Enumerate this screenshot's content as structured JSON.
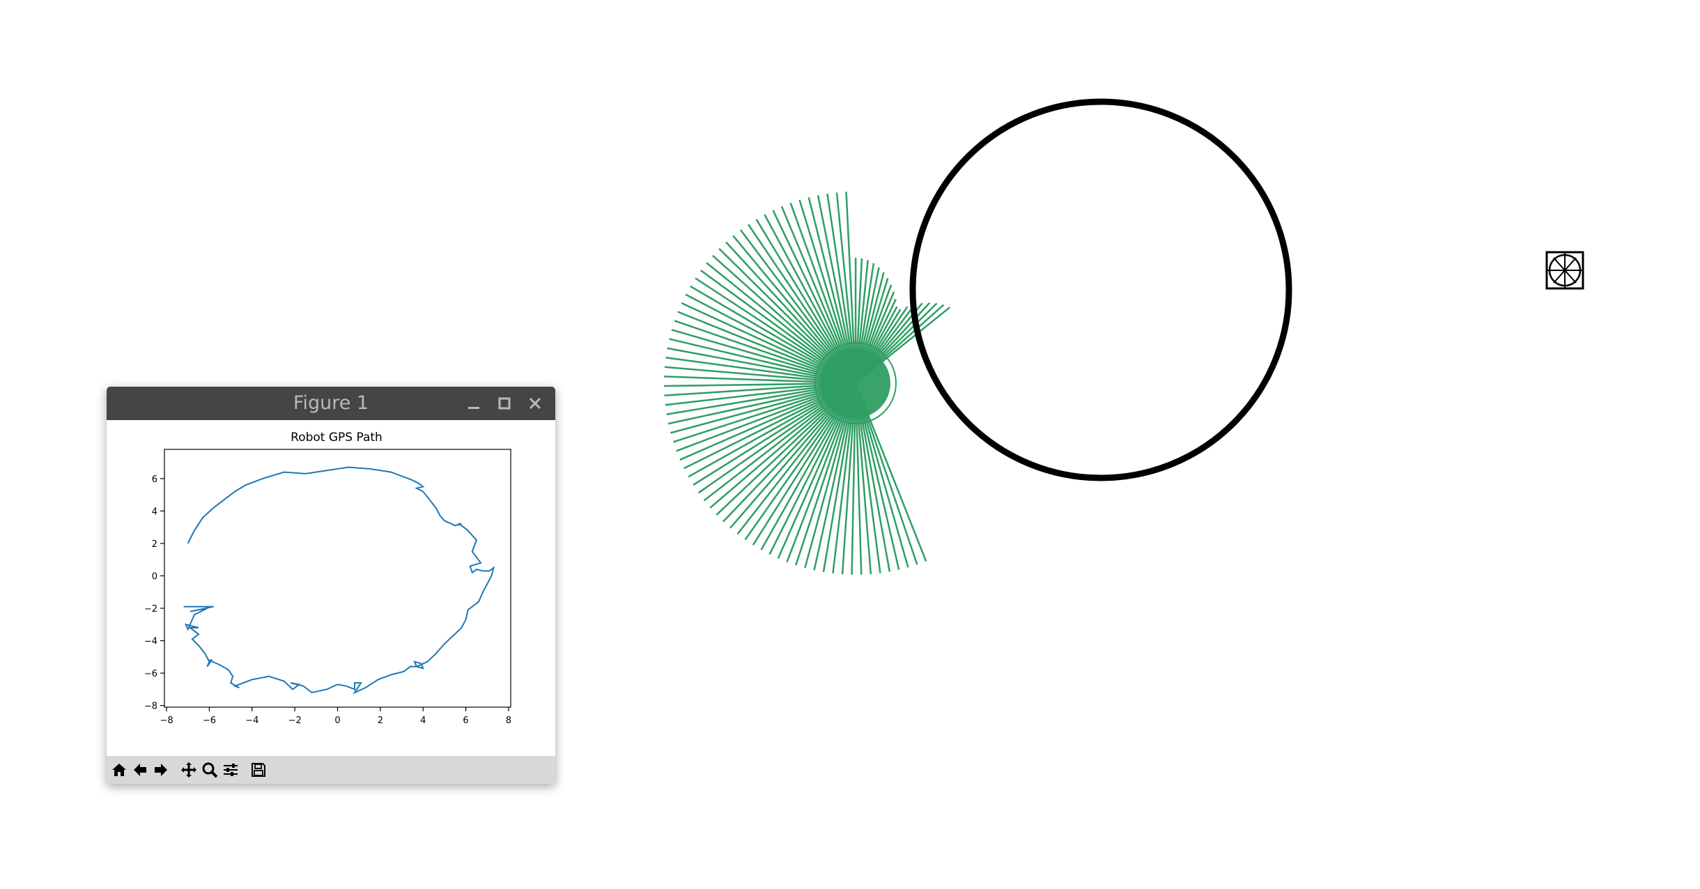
{
  "window": {
    "title": "Figure 1",
    "controls": [
      "minimize-icon",
      "maximize-icon",
      "close-icon"
    ]
  },
  "toolbar": {
    "buttons": [
      {
        "name": "home-icon"
      },
      {
        "name": "back-icon"
      },
      {
        "name": "forward-icon"
      },
      {
        "name": "pan-icon"
      },
      {
        "name": "zoom-icon"
      },
      {
        "name": "configure-subplots-icon"
      },
      {
        "name": "save-icon"
      }
    ]
  },
  "colors": {
    "titlebar": "#454545",
    "title_text": "#b9b9b9",
    "path_line": "#1f77b4",
    "ray_green": "#2e9e63",
    "circle": "#000000",
    "toolbar_bg": "#d8d8d8"
  },
  "scene": {
    "rays": 90,
    "ray_color_name": "green"
  },
  "chart_data": {
    "type": "line",
    "title": "Robot GPS Path",
    "xlabel": "",
    "ylabel": "",
    "xlim": [
      -8.1,
      8.1
    ],
    "ylim": [
      -8.1,
      7.8
    ],
    "xticks": [
      "−8",
      "−6",
      "−4",
      "−2",
      "0",
      "2",
      "4",
      "6",
      "8"
    ],
    "yticks": [
      "−8",
      "−6",
      "−4",
      "−2",
      "0",
      "2",
      "4",
      "6"
    ],
    "grid": false,
    "series": [
      {
        "x": [
          -7.2,
          -5.8,
          -6.9,
          -6.1,
          -6.7,
          -7.0,
          -7.1,
          -6.5,
          -6.9,
          -6.5,
          -6.8,
          -6.5,
          -6.2,
          -6.0,
          -6.1,
          -5.9,
          -6.0,
          -5.5,
          -5.1,
          -4.9,
          -5.0,
          -4.6,
          -4.8,
          -4.0,
          -3.2,
          -2.5,
          -2.1,
          -1.8,
          -2.2,
          -1.6,
          -1.2,
          -0.5,
          0.0,
          0.4,
          0.8,
          0.8,
          1.1,
          0.8,
          1.3,
          1.9,
          2.5,
          3.1,
          3.4,
          3.7,
          4.0,
          3.9,
          3.6,
          3.7,
          4.2,
          4.6,
          5.0,
          5.4,
          5.8,
          6.0,
          6.1,
          6.6,
          6.8,
          7.0,
          7.2,
          7.3,
          7.1,
          6.8,
          6.5,
          6.3,
          6.2,
          6.7,
          6.3,
          6.5,
          6.1,
          5.7,
          5.8,
          5.5,
          5.0,
          4.8,
          4.6,
          4.3,
          4.0,
          3.7,
          4.0,
          3.8,
          3.5,
          2.5,
          1.5,
          0.5,
          -0.5,
          -1.5,
          -2.5,
          -3.5,
          -4.3,
          -4.8,
          -5.3,
          -5.8,
          -6.3,
          -6.7,
          -7.0
        ],
        "y": [
          -1.9,
          -1.9,
          -2.2,
          -2.0,
          -2.4,
          -3.3,
          -3.0,
          -3.2,
          -3.2,
          -3.6,
          -3.9,
          -4.3,
          -4.8,
          -5.3,
          -5.6,
          -5.2,
          -5.2,
          -5.5,
          -5.8,
          -6.2,
          -6.6,
          -6.9,
          -6.8,
          -6.4,
          -6.2,
          -6.5,
          -7.0,
          -6.7,
          -6.6,
          -6.8,
          -7.2,
          -7.0,
          -6.7,
          -6.8,
          -7.0,
          -6.6,
          -6.6,
          -7.2,
          -6.9,
          -6.4,
          -6.1,
          -5.9,
          -5.6,
          -5.6,
          -5.7,
          -5.4,
          -5.3,
          -5.6,
          -5.3,
          -4.8,
          -4.2,
          -3.7,
          -3.2,
          -2.7,
          -2.1,
          -1.6,
          -1.0,
          -0.5,
          0.0,
          0.5,
          0.3,
          0.3,
          0.4,
          0.2,
          0.6,
          0.8,
          1.5,
          2.2,
          2.8,
          3.2,
          3.2,
          3.1,
          3.4,
          3.7,
          4.2,
          4.7,
          5.2,
          5.4,
          5.5,
          5.7,
          5.9,
          6.4,
          6.6,
          6.7,
          6.5,
          6.3,
          6.4,
          6.0,
          5.6,
          5.2,
          4.7,
          4.2,
          3.6,
          2.8,
          2.0
        ]
      }
    ]
  }
}
